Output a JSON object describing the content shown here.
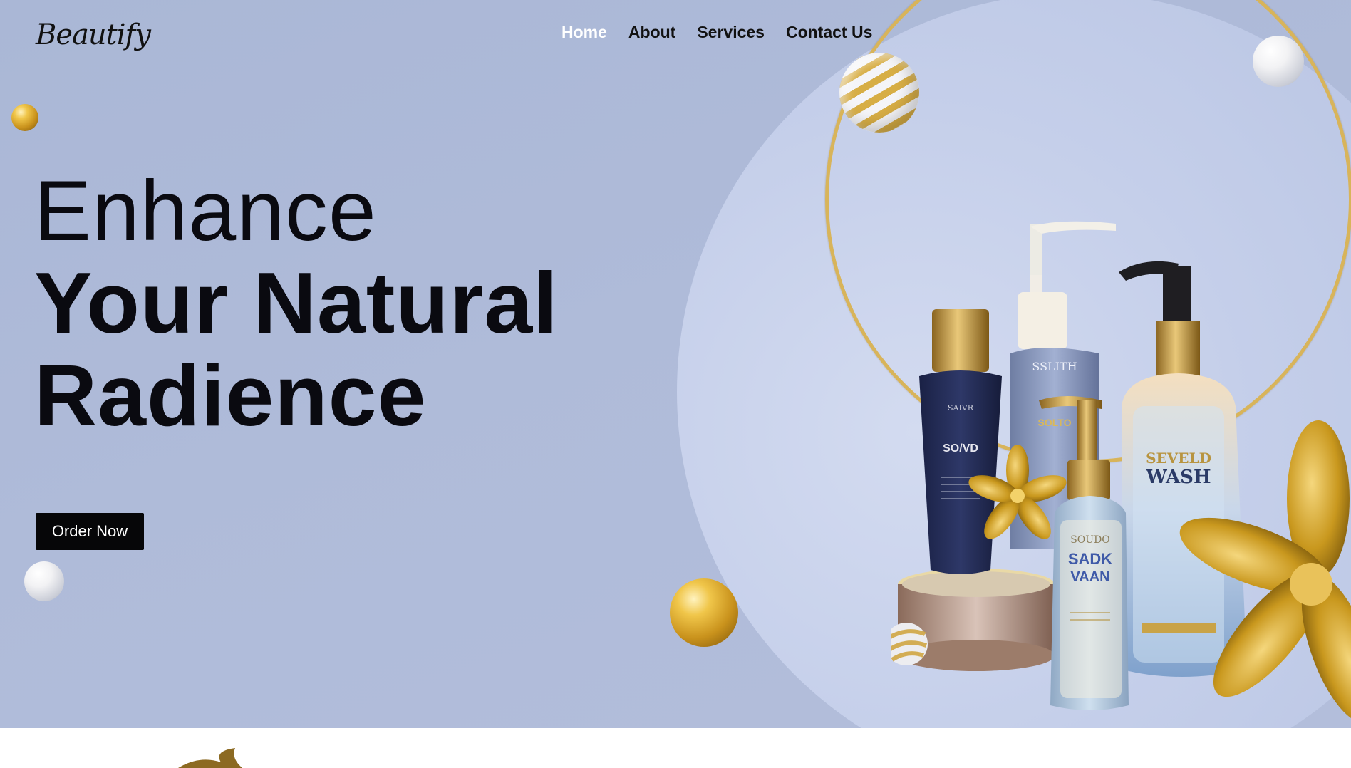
{
  "brand": {
    "logo_text": "Beautify"
  },
  "nav": {
    "items": [
      {
        "label": "Home",
        "active": true
      },
      {
        "label": "About",
        "active": false
      },
      {
        "label": "Services",
        "active": false
      },
      {
        "label": "Contact Us",
        "active": false
      }
    ]
  },
  "hero": {
    "line1": "Enhance",
    "line2": "Your Natural",
    "line3": "Radience",
    "cta_label": "Order Now"
  },
  "products": {
    "bottle_left_label": "SO/VD",
    "bottle_left_top": "SAIVR",
    "bottle_center_label": "SSLITH",
    "bottle_center_sub": "SOLTO",
    "bottle_small_label": "SADK",
    "bottle_small_label2": "VAAN",
    "bottle_small_top": "SOUDO",
    "bottle_right_label": "SEVELD",
    "bottle_right_label2": "WASH"
  },
  "colors": {
    "hero_bg": "#aab7d6",
    "accent_gold": "#d8b45a",
    "cta_bg": "#060608",
    "nav_active": "#ffffff",
    "text_dark": "#0a0a10"
  },
  "icons": {
    "decor": [
      "gold-sphere",
      "pearl-sphere",
      "striped-sphere",
      "gold-flower"
    ]
  }
}
